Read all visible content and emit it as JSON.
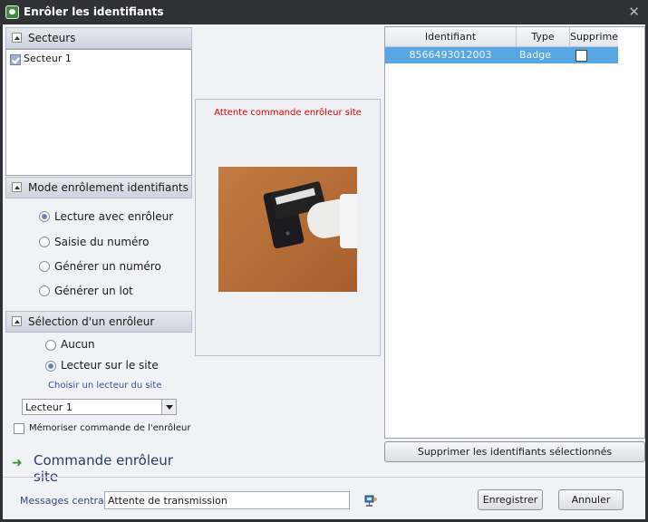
{
  "window": {
    "title": "Enrôler les identifiants",
    "close_icon": "close-icon"
  },
  "sectors": {
    "header": "Secteurs",
    "items": [
      {
        "label": "Secteur 1",
        "checked": true
      }
    ]
  },
  "mode": {
    "header": "Mode enrôlement identifiants",
    "options": [
      {
        "label": "Lecture avec enrôleur",
        "selected": true
      },
      {
        "label": "Saisie du numéro",
        "selected": false
      },
      {
        "label": "Générer un numéro",
        "selected": false
      },
      {
        "label": "Générer un lot",
        "selected": false
      }
    ]
  },
  "enroller": {
    "header": "Sélection d'un enrôleur",
    "options": [
      {
        "label": "Aucun",
        "selected": false
      },
      {
        "label": "Lecteur sur le site",
        "selected": true
      }
    ],
    "choose_label": "Choisir un lecteur du site",
    "selected_reader": "Lecteur 1",
    "memorize_label": "Mémoriser commande de l'enrôleur",
    "memorize_checked": false
  },
  "command": {
    "label": "Commande enrôleur site"
  },
  "center": {
    "status": "Attente commande enrôleur site"
  },
  "table": {
    "columns": [
      "Identifiant",
      "Type",
      "Supprime"
    ],
    "rows": [
      {
        "identifiant": "8566493012003",
        "type": "Badge",
        "supprime": false
      }
    ],
    "delete_button": "Supprimer les identifiants sélectionnés"
  },
  "footer": {
    "messages_label": "Messages centrales",
    "messages_value": "Attente de transmission",
    "save_button": "Enregistrer",
    "cancel_button": "Annuler"
  },
  "colors": {
    "selected_row": "#58a7e2",
    "status_text": "#e00000",
    "title_bar": "#303236"
  }
}
